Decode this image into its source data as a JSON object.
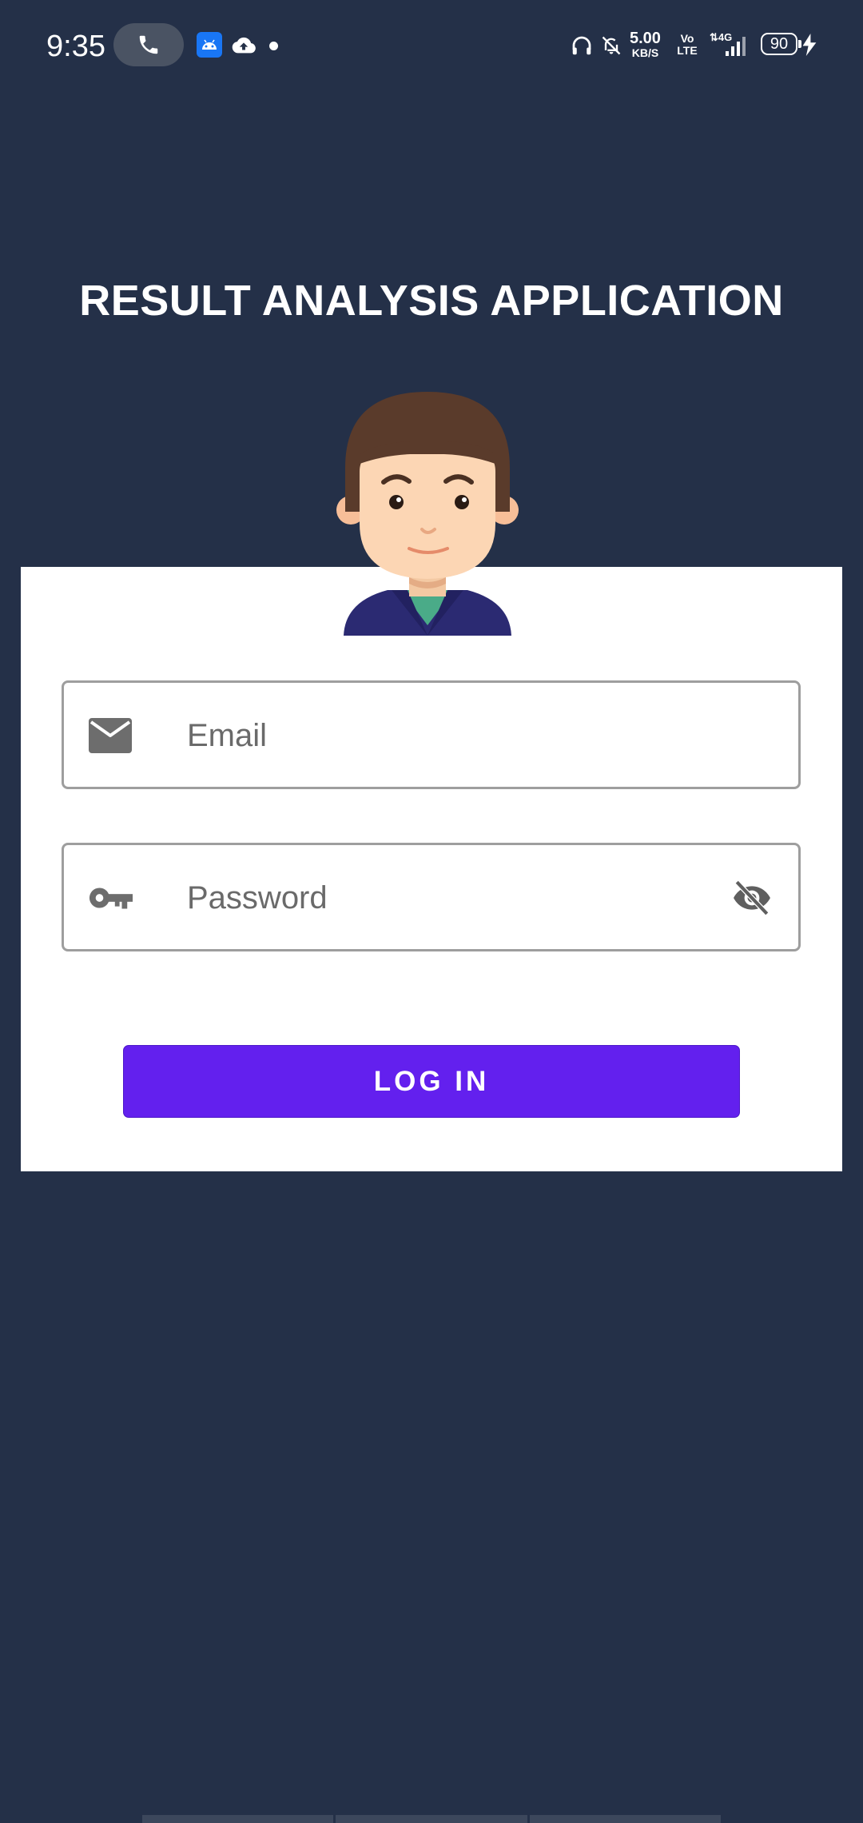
{
  "status_bar": {
    "time": "9:35",
    "network_speed": "5.00",
    "network_speed_unit": "KB/S",
    "volte": "Vo LTE",
    "signal_type": "4G",
    "battery": "90"
  },
  "app": {
    "title": "RESULT ANALYSIS APPLICATION"
  },
  "form": {
    "email_placeholder": "Email",
    "password_placeholder": "Password",
    "login_label": "LOG IN"
  },
  "colors": {
    "background": "#243048",
    "card": "#ffffff",
    "primary_button": "#6320ee"
  },
  "icons": {
    "email": "envelope-icon",
    "password": "key-icon",
    "visibility": "eye-off-icon"
  }
}
